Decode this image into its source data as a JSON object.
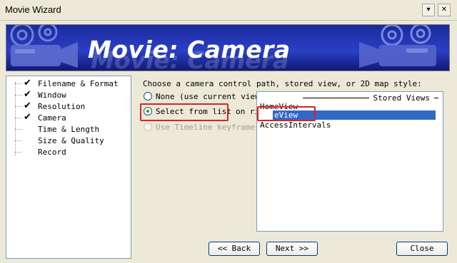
{
  "window": {
    "title": "Movie Wizard"
  },
  "title_buttons": {
    "dropdown": "▾",
    "close": "✕"
  },
  "banner": {
    "title": "Movie: Camera",
    "shadow": "Movie: Camera"
  },
  "steps": [
    {
      "label": "Filename & Format",
      "checked": true
    },
    {
      "label": "Window",
      "checked": true
    },
    {
      "label": "Resolution",
      "checked": true
    },
    {
      "label": "Camera",
      "checked": true
    },
    {
      "label": "Time & Length",
      "checked": false
    },
    {
      "label": "Size & Quality",
      "checked": false
    },
    {
      "label": "Record",
      "checked": false
    }
  ],
  "check_glyph": "✔",
  "main": {
    "prompt": "Choose a camera control path, stored view, or 2D map style:",
    "radios": {
      "none": "None (use current view)",
      "select_list": "Select from list",
      "on_right": "on right:",
      "timeline": "Use Timeline keyframes"
    }
  },
  "list": {
    "header": "Stored Views",
    "items": [
      "HomeView",
      "eView",
      "AccessIntervals"
    ],
    "selected_index": 1
  },
  "buttons": {
    "back": "<< Back",
    "next": "Next >>",
    "close": "Close"
  },
  "highlight_color": "#E02020"
}
